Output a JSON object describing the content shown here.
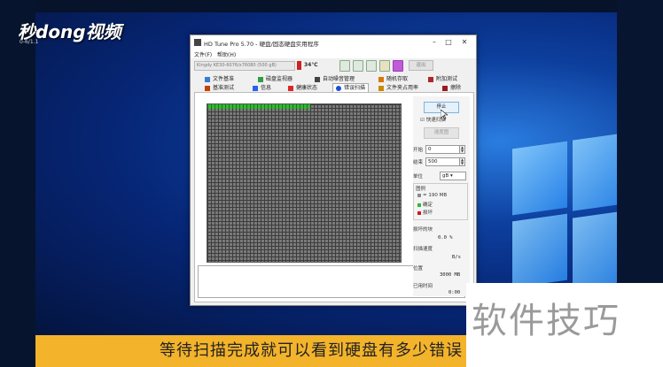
{
  "brand": {
    "name": "秒dong视频",
    "sub": "0-6/1.1"
  },
  "window": {
    "title": "HD Tune Pro 5.70 - 硬盘/固态硬盘实用程序",
    "menu": [
      "文件(F)",
      "帮助(H)"
    ],
    "drive": "Kingdy KE30-6076/x76080 (500 gB)",
    "temperature": "34℃",
    "exit_label": "退出",
    "tabs_row1": [
      {
        "label": "文件基准",
        "icon_color": "#3a7bd5"
      },
      {
        "label": "磁盘监视器",
        "icon_color": "#2f9e44"
      },
      {
        "label": "自动噪音管理",
        "icon_color": "#444444"
      },
      {
        "label": "随机存取",
        "icon_color": "#d97706"
      },
      {
        "label": "附加测试",
        "icon_color": "#b02525"
      }
    ],
    "tabs_row2": [
      {
        "label": "基准测试",
        "icon_color": "#c2410c"
      },
      {
        "label": "信息",
        "icon_color": "#2563eb"
      },
      {
        "label": "健康状态",
        "icon_color": "#dc2626"
      },
      {
        "label": "错误扫描",
        "icon_color": "#1d4ed8",
        "active": true
      },
      {
        "label": "文件夹占用率",
        "icon_color": "#ca8a04"
      },
      {
        "label": "擦除",
        "icon_color": "#991b1b"
      }
    ],
    "scan": {
      "stop_label": "停止",
      "quick_scan_label": "快速扫描",
      "speed_map_label": "速度图",
      "start_label": "开始",
      "start_value": "0",
      "end_label": "结束",
      "end_value": "500",
      "unit_label": "单位",
      "unit_value": "gB",
      "legend_title": "图例",
      "legend_items": [
        {
          "label": "= 190 MB",
          "color": "#8a8a8a"
        },
        {
          "label": "确定",
          "color": "#2fb92f"
        },
        {
          "label": "损坏",
          "color": "#d11a1a"
        }
      ],
      "damaged_blocks_label": "损坏的块",
      "damaged_blocks_value": "0.0 %",
      "scan_speed_label": "扫描速度",
      "scan_speed_value": "B/s",
      "position_label": "位置",
      "position_value": "3000 MB",
      "elapsed_label": "已用时间",
      "elapsed_value": "0:00",
      "progress_fraction": 0.012
    }
  },
  "caption": "等待扫描完成就可以看到硬盘有多少错误",
  "watermark": "软件技巧"
}
